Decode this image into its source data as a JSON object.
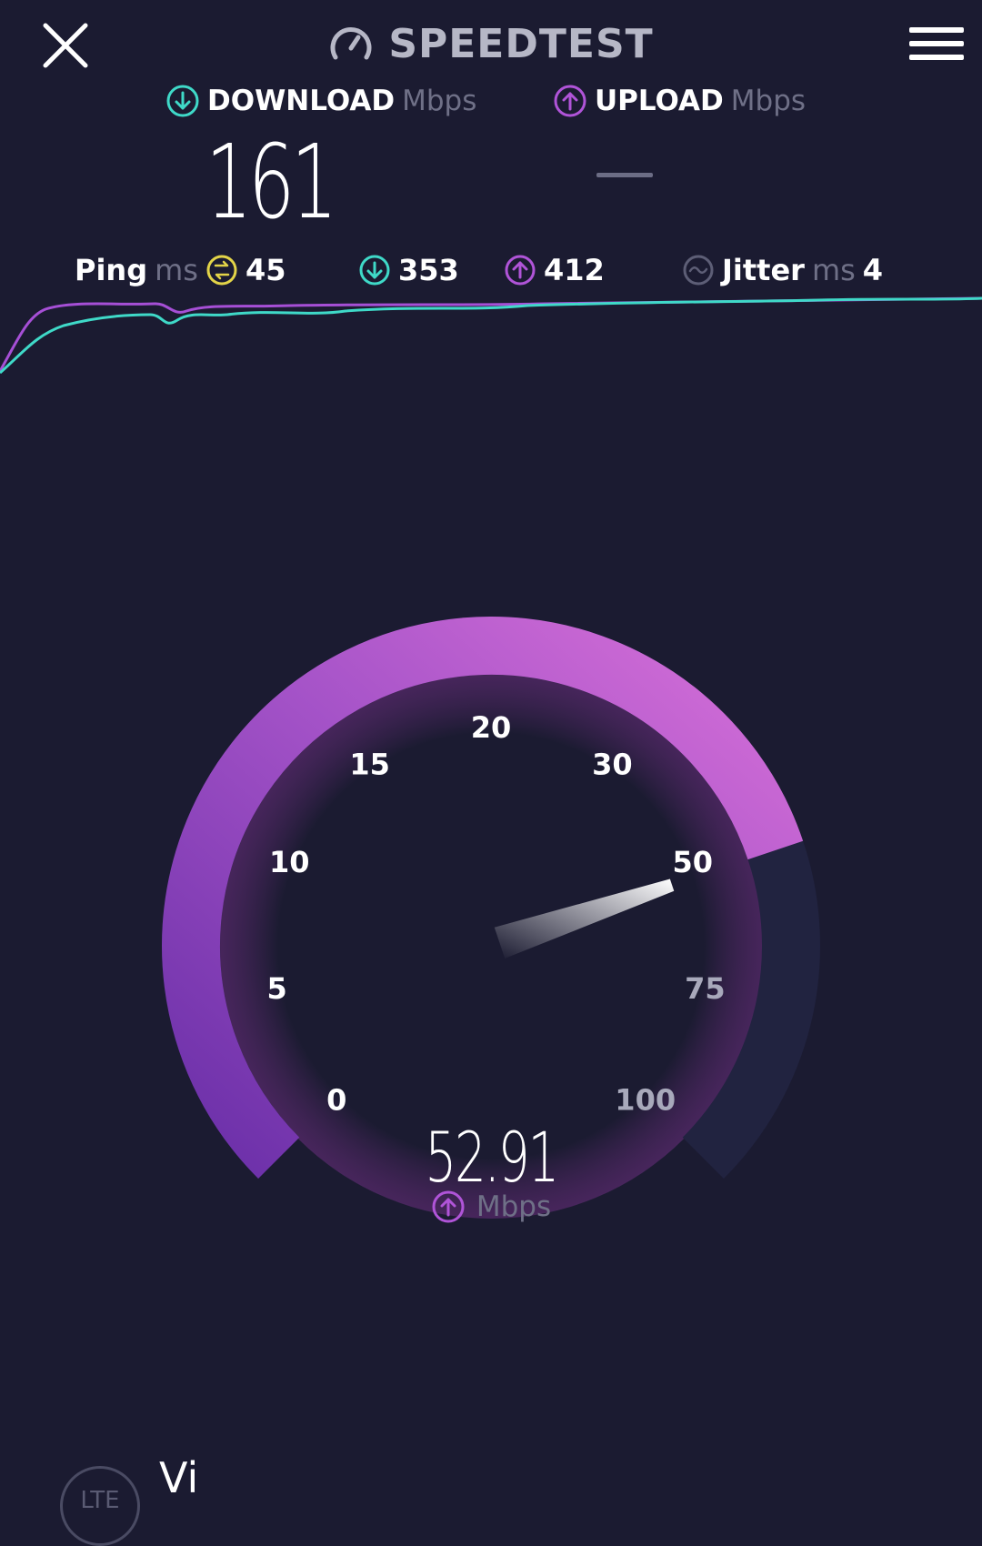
{
  "header": {
    "title": "SPEEDTEST",
    "close_icon": "close-icon",
    "menu_icon": "hamburger-menu-icon",
    "logo_icon": "speedometer-icon"
  },
  "results": {
    "download": {
      "label": "DOWNLOAD",
      "unit": "Mbps",
      "value": "161",
      "icon": "download-arrow-icon"
    },
    "upload": {
      "label": "UPLOAD",
      "unit": "Mbps",
      "value": "—",
      "icon": "upload-arrow-icon"
    }
  },
  "ping_row": {
    "ping_label": "Ping",
    "ping_unit": "ms",
    "ping_value": "45",
    "download_latency": "353",
    "upload_latency": "412",
    "jitter_label": "Jitter",
    "jitter_unit": "ms",
    "jitter_value": "4"
  },
  "gauge": {
    "ticks": [
      "0",
      "5",
      "10",
      "15",
      "20",
      "30",
      "50",
      "75",
      "100"
    ],
    "value": "52.91",
    "unit": "Mbps",
    "current_speed_mbps": 52.91
  },
  "connection": {
    "type": "LTE",
    "provider": "Vi"
  },
  "colors": {
    "background": "#1b1b31",
    "download_accent": "#3fd9c8",
    "upload_accent": "#b054d8",
    "ping_accent": "#e3d448"
  }
}
